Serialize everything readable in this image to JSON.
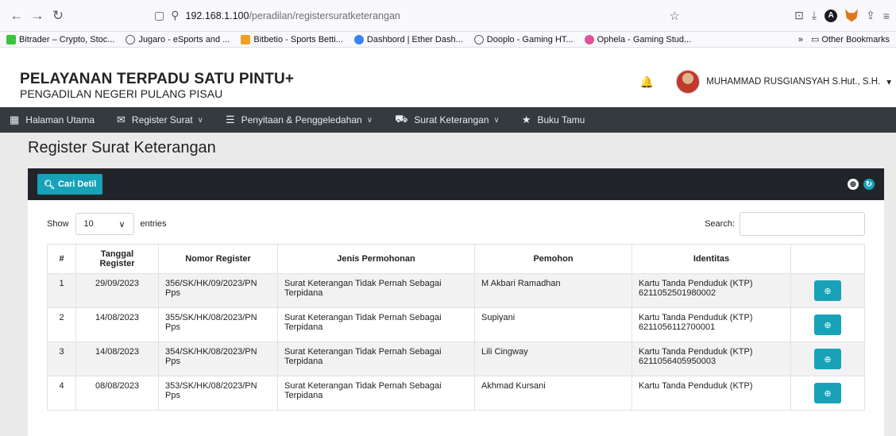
{
  "browser": {
    "url_host": "192.168.1.100",
    "url_path": "/peradilan/registersuratketerangan",
    "bookmarks": [
      {
        "label": "Bitrader – Crypto, Stoc...",
        "color": "#3cc23c"
      },
      {
        "label": "Jugaro - eSports and ...",
        "color": "#5b5b66"
      },
      {
        "label": "Bitbetio - Sports Betti...",
        "color": "#f0a020"
      },
      {
        "label": "Dashbord | Ether Dash...",
        "color": "#3b82f6"
      },
      {
        "label": "Dooplo - Gaming HT...",
        "color": "#5b5b66"
      },
      {
        "label": "Ophela - Gaming Stud...",
        "color": "#e0529c"
      }
    ],
    "other_bookmarks": "Other Bookmarks"
  },
  "header": {
    "title": "PELAYANAN TERPADU SATU PINTU+",
    "subtitle": "PENGADILAN NEGERI PULANG PISAU",
    "user_name": "MUHAMMAD RUSGIANSYAH S.Hut., S.H."
  },
  "nav": {
    "items": [
      {
        "label": "Halaman Utama",
        "icon": "grid-icon"
      },
      {
        "label": "Register Surat",
        "icon": "envelope-icon"
      },
      {
        "label": "Penyitaan & Penggeledahan",
        "icon": "list-icon"
      },
      {
        "label": "Surat Keterangan",
        "icon": "car-icon"
      },
      {
        "label": "Buku Tamu",
        "icon": "star-icon"
      }
    ]
  },
  "page": {
    "title": "Register Surat Keterangan",
    "search_button": "Cari Detil",
    "show_label": "Show",
    "entries_value": "10",
    "entries_label": "entries",
    "search_label": "Search:"
  },
  "table": {
    "headers": [
      "#",
      "Tanggal Register",
      "Nomor Register",
      "Jenis Permohonan",
      "Pemohon",
      "Identitas"
    ],
    "rows": [
      {
        "num": "1",
        "tanggal": "29/09/2023",
        "nomor": "356/SK/HK/09/2023/PN Pps",
        "jenis": "Surat Keterangan Tidak Pernah Sebagai Terpidana",
        "pemohon": "M Akbari Ramadhan",
        "identitas_type": "Kartu Tanda Penduduk (KTP)",
        "identitas_no": "6211052501980002"
      },
      {
        "num": "2",
        "tanggal": "14/08/2023",
        "nomor": "355/SK/HK/08/2023/PN Pps",
        "jenis": "Surat Keterangan Tidak Pernah Sebagai Terpidana",
        "pemohon": "Supiyani",
        "identitas_type": "Kartu Tanda Penduduk (KTP)",
        "identitas_no": "6211056112700001"
      },
      {
        "num": "3",
        "tanggal": "14/08/2023",
        "nomor": "354/SK/HK/08/2023/PN Pps",
        "jenis": "Surat Keterangan Tidak Pernah Sebagai Terpidana",
        "pemohon": "Lili Cingway",
        "identitas_type": "Kartu Tanda Penduduk (KTP)",
        "identitas_no": "6211056405950003"
      },
      {
        "num": "4",
        "tanggal": "08/08/2023",
        "nomor": "353/SK/HK/08/2023/PN Pps",
        "jenis": "Surat Keterangan Tidak Pernah Sebagai Terpidana",
        "pemohon": "Akhmad Kursani",
        "identitas_type": "Kartu Tanda Penduduk (KTP)",
        "identitas_no": ""
      }
    ]
  },
  "colors": {
    "accent": "#17a2b8",
    "navbar": "#343a40",
    "card_header": "#212529"
  }
}
